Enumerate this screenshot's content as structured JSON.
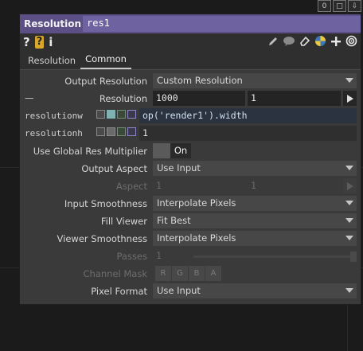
{
  "window": {
    "corner_buttons": [
      "0",
      "□",
      "⇩"
    ]
  },
  "header": {
    "op_type": "Resolution",
    "op_name": "res1"
  },
  "toolbar": {
    "help": "?",
    "python_help": "?",
    "info": "i"
  },
  "tabs": [
    {
      "label": "Resolution"
    },
    {
      "label": "Common"
    }
  ],
  "params": {
    "output_resolution": {
      "label": "Output Resolution",
      "value": "Custom Resolution"
    },
    "resolution": {
      "dash": "—",
      "label": "Resolution",
      "w": "1000",
      "h": "1"
    },
    "resolutionw": {
      "name": "resolutionw",
      "expr": "op('render1').width"
    },
    "resolutionh": {
      "name": "resolutionh",
      "value": "1"
    },
    "global_res": {
      "label": "Use Global Res Multiplier",
      "value": "On"
    },
    "output_aspect": {
      "label": "Output Aspect",
      "value": "Use Input"
    },
    "aspect": {
      "label": "Aspect",
      "v1": "1",
      "v2": "1"
    },
    "input_smoothness": {
      "label": "Input Smoothness",
      "value": "Interpolate Pixels"
    },
    "fill_viewer": {
      "label": "Fill Viewer",
      "value": "Fit Best"
    },
    "viewer_smoothness": {
      "label": "Viewer Smoothness",
      "value": "Interpolate Pixels"
    },
    "passes": {
      "label": "Passes",
      "value": "1"
    },
    "channel_mask": {
      "label": "Channel Mask",
      "channels": [
        "R",
        "G",
        "B",
        "A"
      ]
    },
    "pixel_format": {
      "label": "Pixel Format",
      "value": "Use Input"
    }
  },
  "colors": {
    "header": "#5b4f86",
    "expression": "#2b3340",
    "panel": "#3a3a3a"
  }
}
